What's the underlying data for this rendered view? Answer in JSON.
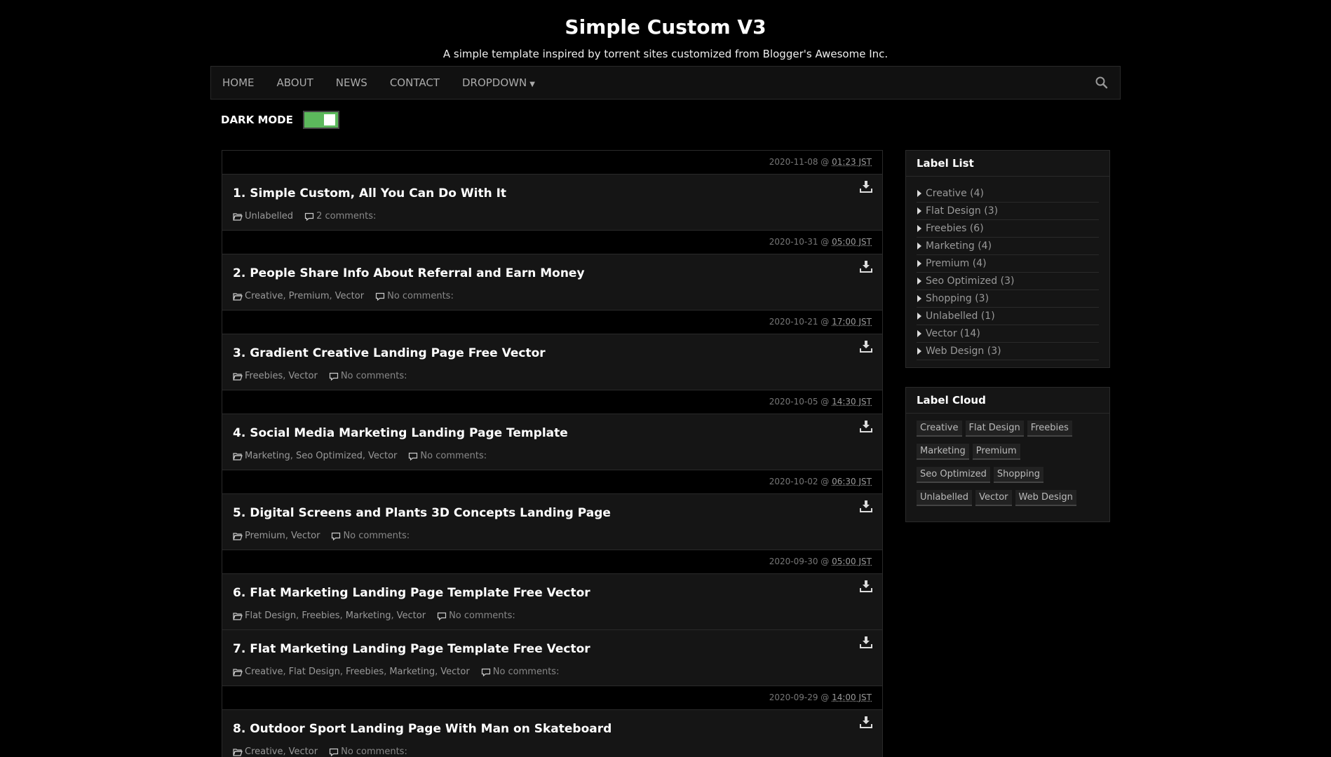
{
  "header": {
    "title": "Simple Custom V3",
    "description": "A simple template inspired by torrent sites customized from Blogger's Awesome Inc."
  },
  "nav": {
    "items": [
      "HOME",
      "ABOUT",
      "NEWS",
      "CONTACT",
      "DROPDOWN"
    ],
    "search_icon": "search-icon"
  },
  "dark_mode": {
    "label": "DARK MODE",
    "enabled": true,
    "color": "#5cb85c"
  },
  "posts": [
    {
      "date": "2020-11-08 @ ",
      "time": "01:23 JST",
      "title": "1. Simple Custom, All You Can Do With It",
      "labels": [
        "Unlabelled"
      ],
      "comments": "2 comments:"
    },
    {
      "date": "2020-10-31 @ ",
      "time": "05:00 JST",
      "title": "2. People Share Info About Referral and Earn Money",
      "labels": [
        "Creative",
        "Premium",
        "Vector"
      ],
      "comments": "No comments:"
    },
    {
      "date": "2020-10-21 @ ",
      "time": "17:00 JST",
      "title": "3. Gradient Creative Landing Page Free Vector",
      "labels": [
        "Freebies",
        "Vector"
      ],
      "comments": "No comments:"
    },
    {
      "date": "2020-10-05 @ ",
      "time": "14:30 JST",
      "title": "4. Social Media Marketing Landing Page Template",
      "labels": [
        "Marketing",
        "Seo Optimized",
        "Vector"
      ],
      "comments": "No comments:"
    },
    {
      "date": "2020-10-02 @ ",
      "time": "06:30 JST",
      "title": "5. Digital Screens and Plants 3D Concepts Landing Page",
      "labels": [
        "Premium",
        "Vector"
      ],
      "comments": "No comments:"
    },
    {
      "date": "2020-09-30 @ ",
      "time": "05:00 JST",
      "title": "6. Flat Marketing Landing Page Template Free Vector",
      "labels": [
        "Flat Design",
        "Freebies",
        "Marketing",
        "Vector"
      ],
      "comments": "No comments:"
    },
    {
      "date": "",
      "time": "",
      "title": "7. Flat Marketing Landing Page Template Free Vector",
      "labels": [
        "Creative",
        "Flat Design",
        "Freebies",
        "Marketing",
        "Vector"
      ],
      "comments": "No comments:"
    },
    {
      "date": "2020-09-29 @ ",
      "time": "14:00 JST",
      "title": "8. Outdoor Sport Landing Page With Man on Skateboard",
      "labels": [
        "Creative",
        "Vector"
      ],
      "comments": "No comments:"
    }
  ],
  "sidebar": {
    "label_list_title": "Label List",
    "label_list": [
      "Creative (4)",
      "Flat Design (3)",
      "Freebies (6)",
      "Marketing (4)",
      "Premium (4)",
      "Seo Optimized (3)",
      "Shopping (3)",
      "Unlabelled (1)",
      "Vector (14)",
      "Web Design (3)"
    ],
    "label_cloud_title": "Label Cloud",
    "label_cloud": [
      "Creative",
      "Flat Design",
      "Freebies",
      "Marketing",
      "Premium",
      "Seo Optimized",
      "Shopping",
      "Unlabelled",
      "Vector",
      "Web Design"
    ]
  }
}
